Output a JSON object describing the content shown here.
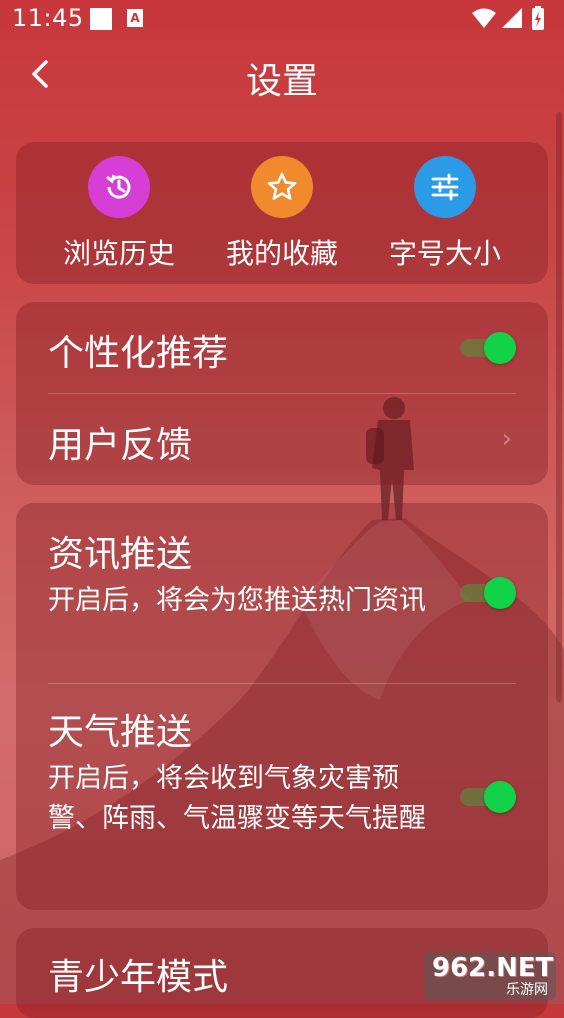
{
  "status_bar": {
    "time": "11:45",
    "notification_icon": "A"
  },
  "header": {
    "title": "设置",
    "back_icon": "chevron-left-icon"
  },
  "quick_actions": [
    {
      "label": "浏览历史",
      "icon": "history-icon",
      "color": "#d63fd6"
    },
    {
      "label": "我的收藏",
      "icon": "star-icon",
      "color": "#f08a2d"
    },
    {
      "label": "字号大小",
      "icon": "sliders-icon",
      "color": "#2b9be8"
    }
  ],
  "settings_group_1": {
    "personalized": {
      "title": "个性化推荐",
      "enabled": true
    },
    "feedback": {
      "title": "用户反馈"
    }
  },
  "settings_group_2": {
    "news_push": {
      "title": "资讯推送",
      "desc": "开启后，将会为您推送热门资讯",
      "enabled": true
    },
    "weather_push": {
      "title": "天气推送",
      "desc": "开启后，将会收到气象灾害预警、阵雨、气温骤变等天气提醒",
      "enabled": true
    }
  },
  "settings_group_3": {
    "teen_mode": {
      "title": "青少年模式"
    }
  },
  "watermark": {
    "brand": "962.NET",
    "sub": "乐游网"
  },
  "colors": {
    "toggle_on": "#12d247",
    "background": "#c7373b"
  }
}
